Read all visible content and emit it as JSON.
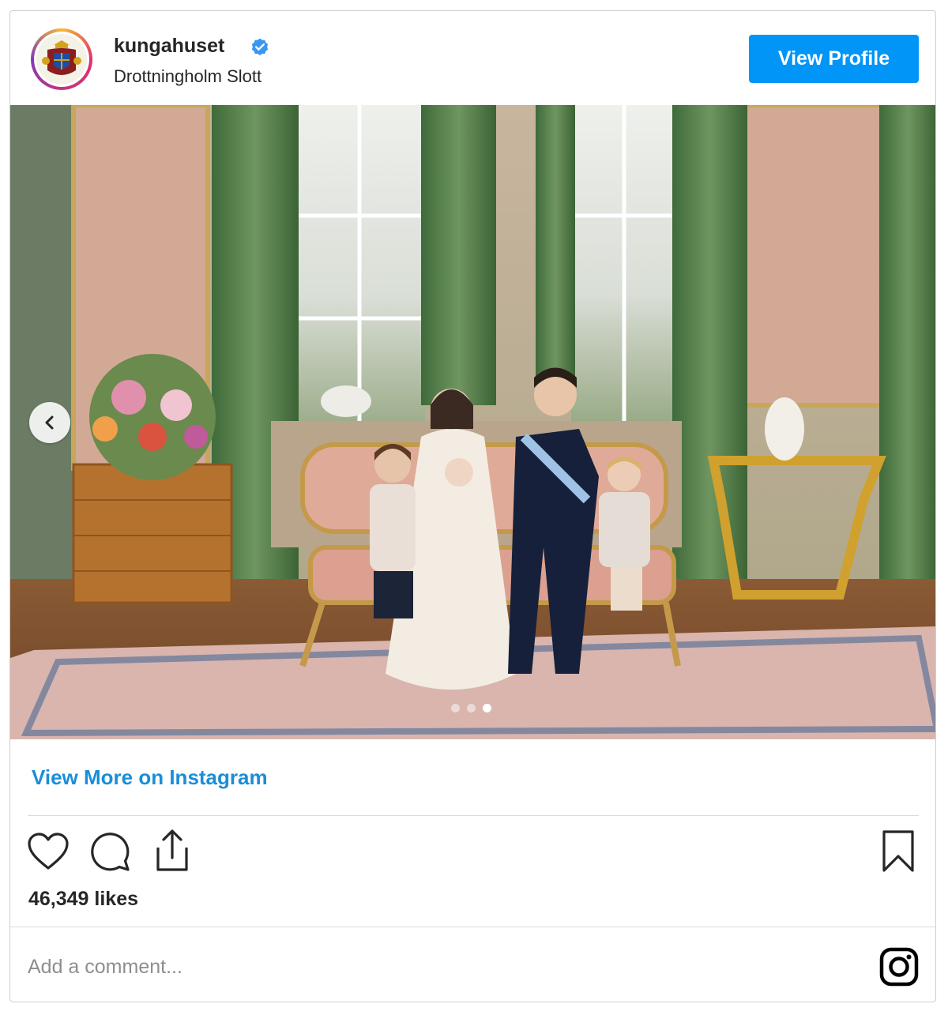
{
  "post": {
    "username": "kungahuset",
    "location": "Drottningholm Slott",
    "view_profile_label": "View Profile",
    "view_more_label": "View More on Instagram",
    "likes_text": "46,349 likes",
    "comment_placeholder": "Add a comment...",
    "carousel": {
      "slide_count": 3,
      "active_index": 2
    },
    "colors": {
      "accent": "#0095f6",
      "link": "#1a8ed8",
      "text": "#262626",
      "muted": "#8e8e8e",
      "border": "#dbdbdb"
    },
    "icons": [
      "verified-badge-icon",
      "chevron-left-icon",
      "heart-icon",
      "comment-icon",
      "share-icon",
      "bookmark-icon",
      "instagram-logo-icon"
    ]
  }
}
